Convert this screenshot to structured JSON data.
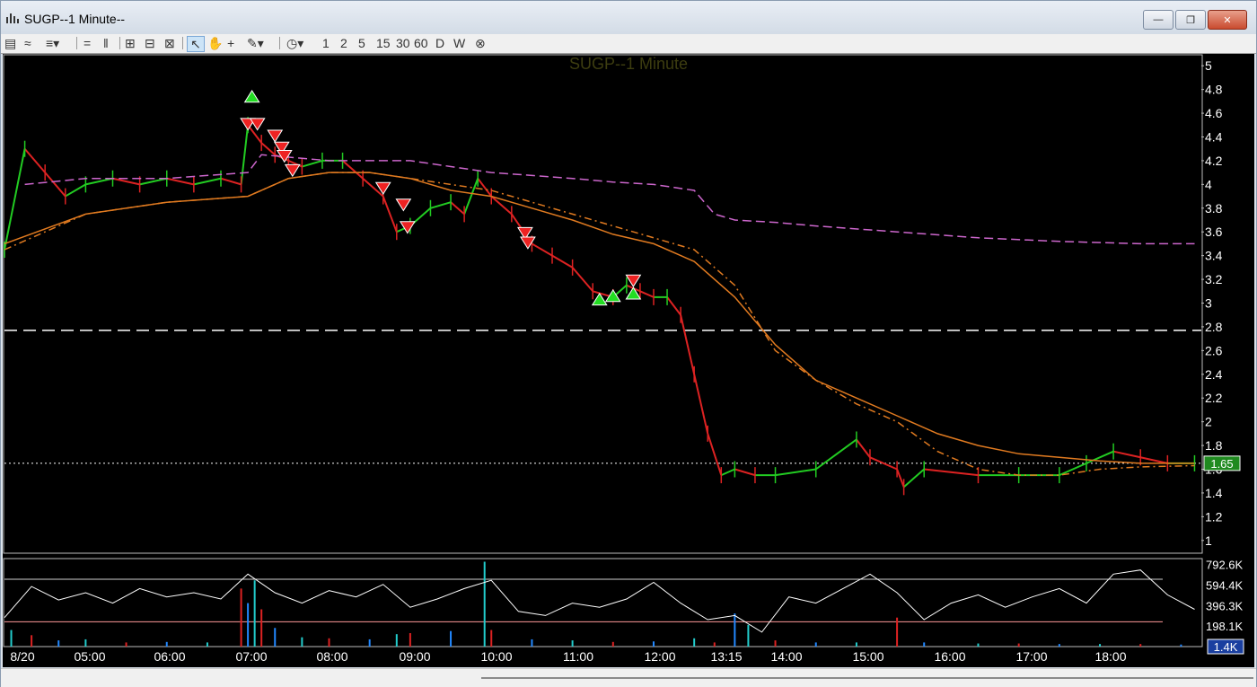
{
  "window": {
    "title": "SUGP--1 Minute--",
    "buttons": [
      "minimize",
      "restore",
      "close"
    ]
  },
  "toolbar": {
    "intervals": [
      "1",
      "2",
      "5",
      "15",
      "30",
      "60",
      "D",
      "W"
    ]
  },
  "colors": {
    "background": "#000000",
    "up_candle": "#22cc22",
    "down_candle": "#dd2222",
    "ma_solid": "#e07a20",
    "ma_dashed": "#e07a20",
    "vwap": "#cc66cc",
    "oscillator": "#ffffff",
    "buy_marker": "#22dd22",
    "sell_marker": "#ee2222",
    "last_price_label": "#1f8a1f"
  },
  "chart_data": [
    {
      "type": "line",
      "title": "SUGP--1 Minute",
      "x_ticks": [
        "8/20",
        "05:00",
        "06:00",
        "07:00",
        "08:00",
        "09:00",
        "10:00",
        "11:00",
        "12:00",
        "13:15",
        "14:00",
        "15:00",
        "16:00",
        "17:00",
        "18:00"
      ],
      "x_range": [
        "04:00",
        "18:45"
      ],
      "y_ticks": [
        1,
        1.2,
        1.4,
        1.6,
        1.8,
        2,
        2.2,
        2.4,
        2.6,
        2.8,
        3,
        3.2,
        3.4,
        3.6,
        3.8,
        4,
        4.2,
        4.4,
        4.6,
        4.8,
        5
      ],
      "y_tick_labels": [
        "1",
        "1.2",
        "1.4",
        "1.6",
        "1.8",
        "2",
        "2.2",
        "2.4",
        "2.6",
        "2.8",
        "3",
        "3.2",
        "3.4",
        "3.6",
        "3.8",
        "4",
        "4.2",
        "4.4",
        "4.6",
        "4.8",
        "5"
      ],
      "ylim": [
        0.9,
        5.1
      ],
      "last_price": 1.65,
      "last_price_label": "1.65",
      "horizontal_lines": [
        {
          "value": 2.77,
          "style": "dashed"
        },
        {
          "value": 1.65,
          "style": "dotted"
        }
      ],
      "series": [
        {
          "style": "candle-close",
          "x": [
            "04:00",
            "04:15",
            "04:30",
            "04:45",
            "05:00",
            "05:20",
            "05:40",
            "06:00",
            "06:20",
            "06:40",
            "06:55",
            "07:00",
            "07:10",
            "07:20",
            "07:30",
            "07:40",
            "07:55",
            "08:10",
            "08:25",
            "08:40",
            "08:50",
            "09:00",
            "09:15",
            "09:30",
            "09:40",
            "09:50",
            "10:00",
            "10:15",
            "10:30",
            "10:45",
            "11:00",
            "11:15",
            "11:30",
            "11:40",
            "11:50",
            "12:00",
            "12:10",
            "12:20",
            "12:30",
            "12:40",
            "12:50",
            "13:00",
            "13:15",
            "13:30",
            "14:00",
            "14:30",
            "14:40",
            "15:00",
            "15:05",
            "15:20",
            "16:00",
            "16:30",
            "17:00",
            "17:20",
            "17:40",
            "18:00",
            "18:20",
            "18:40"
          ],
          "values": [
            3.45,
            4.3,
            4.1,
            3.9,
            4.0,
            4.05,
            4.0,
            4.05,
            4.0,
            4.05,
            4.0,
            4.5,
            4.35,
            4.25,
            4.2,
            4.15,
            4.2,
            4.2,
            4.05,
            3.9,
            3.6,
            3.65,
            3.8,
            3.85,
            3.75,
            4.05,
            3.9,
            3.75,
            3.5,
            3.4,
            3.3,
            3.1,
            3.05,
            3.15,
            3.1,
            3.05,
            3.05,
            2.9,
            2.4,
            1.9,
            1.55,
            1.6,
            1.55,
            1.55,
            1.6,
            1.85,
            1.7,
            1.6,
            1.45,
            1.6,
            1.55,
            1.55,
            1.55,
            1.65,
            1.75,
            1.7,
            1.65,
            1.65
          ]
        },
        {
          "style": "solid",
          "x": [
            "04:00",
            "05:00",
            "06:00",
            "07:00",
            "07:30",
            "08:00",
            "08:30",
            "09:00",
            "09:30",
            "10:00",
            "10:30",
            "11:00",
            "11:30",
            "12:00",
            "12:30",
            "13:00",
            "13:30",
            "14:00",
            "14:30",
            "15:00",
            "15:30",
            "16:00",
            "16:30",
            "17:00",
            "17:30",
            "18:00",
            "18:40"
          ],
          "values": [
            3.5,
            3.75,
            3.85,
            3.9,
            4.05,
            4.1,
            4.1,
            4.05,
            3.95,
            3.9,
            3.8,
            3.7,
            3.58,
            3.5,
            3.35,
            3.05,
            2.65,
            2.35,
            2.2,
            2.05,
            1.9,
            1.8,
            1.73,
            1.7,
            1.67,
            1.65,
            1.65
          ]
        },
        {
          "style": "dashed",
          "x": [
            "04:00",
            "05:00",
            "06:00",
            "07:00",
            "07:30",
            "08:00",
            "08:30",
            "09:00",
            "09:30",
            "10:00",
            "10:30",
            "11:00",
            "11:30",
            "12:00",
            "12:30",
            "13:00",
            "13:30",
            "14:00",
            "14:30",
            "15:00",
            "15:30",
            "16:00",
            "16:30",
            "17:00",
            "17:30",
            "18:00",
            "18:40"
          ],
          "values": [
            3.45,
            3.75,
            3.85,
            3.9,
            4.05,
            4.1,
            4.1,
            4.05,
            4.0,
            3.95,
            3.85,
            3.75,
            3.65,
            3.55,
            3.45,
            3.15,
            2.6,
            2.35,
            2.15,
            2.0,
            1.75,
            1.6,
            1.55,
            1.55,
            1.6,
            1.62,
            1.63
          ]
        },
        {
          "style": "dashed",
          "x": [
            "04:15",
            "05:00",
            "06:00",
            "07:00",
            "07:10",
            "08:00",
            "09:00",
            "09:30",
            "10:00",
            "11:00",
            "11:30",
            "12:00",
            "12:30",
            "12:45",
            "13:00",
            "13:30",
            "14:00",
            "15:00",
            "16:00",
            "17:00",
            "18:00",
            "18:40"
          ],
          "values": [
            4.0,
            4.05,
            4.05,
            4.1,
            4.25,
            4.2,
            4.2,
            4.15,
            4.1,
            4.05,
            4.02,
            4.0,
            3.95,
            3.75,
            3.7,
            3.68,
            3.65,
            3.6,
            3.55,
            3.52,
            3.5,
            3.5
          ]
        }
      ],
      "buy_signals": [
        {
          "x": "07:03",
          "y": 4.73
        },
        {
          "x": "11:20",
          "y": 3.02
        },
        {
          "x": "11:30",
          "y": 3.05
        },
        {
          "x": "11:45",
          "y": 3.07
        }
      ],
      "sell_signals": [
        {
          "x": "07:00",
          "y": 4.52
        },
        {
          "x": "07:07",
          "y": 4.52
        },
        {
          "x": "07:20",
          "y": 4.42
        },
        {
          "x": "07:25",
          "y": 4.32
        },
        {
          "x": "07:27",
          "y": 4.25
        },
        {
          "x": "07:33",
          "y": 4.13
        },
        {
          "x": "08:40",
          "y": 3.98
        },
        {
          "x": "08:55",
          "y": 3.84
        },
        {
          "x": "08:58",
          "y": 3.65
        },
        {
          "x": "10:25",
          "y": 3.6
        },
        {
          "x": "10:27",
          "y": 3.52
        },
        {
          "x": "11:45",
          "y": 3.2
        }
      ]
    },
    {
      "type": "bar",
      "title": "",
      "y_tick_labels": [
        "792.6K",
        "594.4K",
        "396.3K",
        "198.1K"
      ],
      "y_ticks": [
        792600,
        594400,
        396300,
        198100
      ],
      "ylim": [
        0,
        850000
      ],
      "last_value_label": "1.4K",
      "horizontal_lines": [
        {
          "value": 650000,
          "color": "#cfcfcf"
        },
        {
          "value": 240000,
          "color": "#ff9999"
        }
      ],
      "oscillator": {
        "x": [
          "04:00",
          "04:20",
          "04:40",
          "05:00",
          "05:20",
          "05:40",
          "06:00",
          "06:20",
          "06:40",
          "07:00",
          "07:20",
          "07:40",
          "08:00",
          "08:20",
          "08:40",
          "09:00",
          "09:20",
          "09:40",
          "10:00",
          "10:20",
          "10:40",
          "11:00",
          "11:20",
          "11:40",
          "12:00",
          "12:20",
          "12:40",
          "13:00",
          "13:20",
          "13:40",
          "14:00",
          "14:20",
          "14:40",
          "15:00",
          "15:20",
          "15:40",
          "16:00",
          "16:20",
          "16:40",
          "17:00",
          "17:20",
          "17:40",
          "18:00",
          "18:20",
          "18:40"
        ],
        "values": [
          280000,
          580000,
          450000,
          520000,
          420000,
          560000,
          480000,
          520000,
          460000,
          700000,
          520000,
          420000,
          540000,
          480000,
          600000,
          380000,
          460000,
          560000,
          640000,
          340000,
          300000,
          420000,
          380000,
          460000,
          620000,
          420000,
          260000,
          300000,
          140000,
          480000,
          420000,
          560000,
          700000,
          520000,
          260000,
          420000,
          500000,
          380000,
          480000,
          560000,
          420000,
          700000,
          740000,
          500000,
          360000
        ]
      },
      "volume": {
        "x": [
          "04:05",
          "04:20",
          "04:40",
          "05:00",
          "05:30",
          "06:00",
          "06:30",
          "06:55",
          "07:00",
          "07:05",
          "07:10",
          "07:20",
          "07:40",
          "08:00",
          "08:30",
          "08:50",
          "09:00",
          "09:30",
          "09:55",
          "10:00",
          "10:30",
          "11:00",
          "11:30",
          "12:00",
          "12:30",
          "12:45",
          "13:00",
          "13:10",
          "13:30",
          "14:00",
          "14:30",
          "15:00",
          "15:20",
          "16:00",
          "16:30",
          "17:00",
          "17:30",
          "18:00",
          "18:30"
        ],
        "values": [
          160000,
          110000,
          60000,
          70000,
          40000,
          45000,
          40000,
          560000,
          420000,
          640000,
          360000,
          180000,
          90000,
          80000,
          70000,
          120000,
          130000,
          150000,
          820000,
          160000,
          70000,
          60000,
          45000,
          50000,
          80000,
          40000,
          320000,
          210000,
          60000,
          40000,
          40000,
          280000,
          40000,
          30000,
          30000,
          25000,
          25000,
          25000,
          20000
        ]
      }
    }
  ]
}
